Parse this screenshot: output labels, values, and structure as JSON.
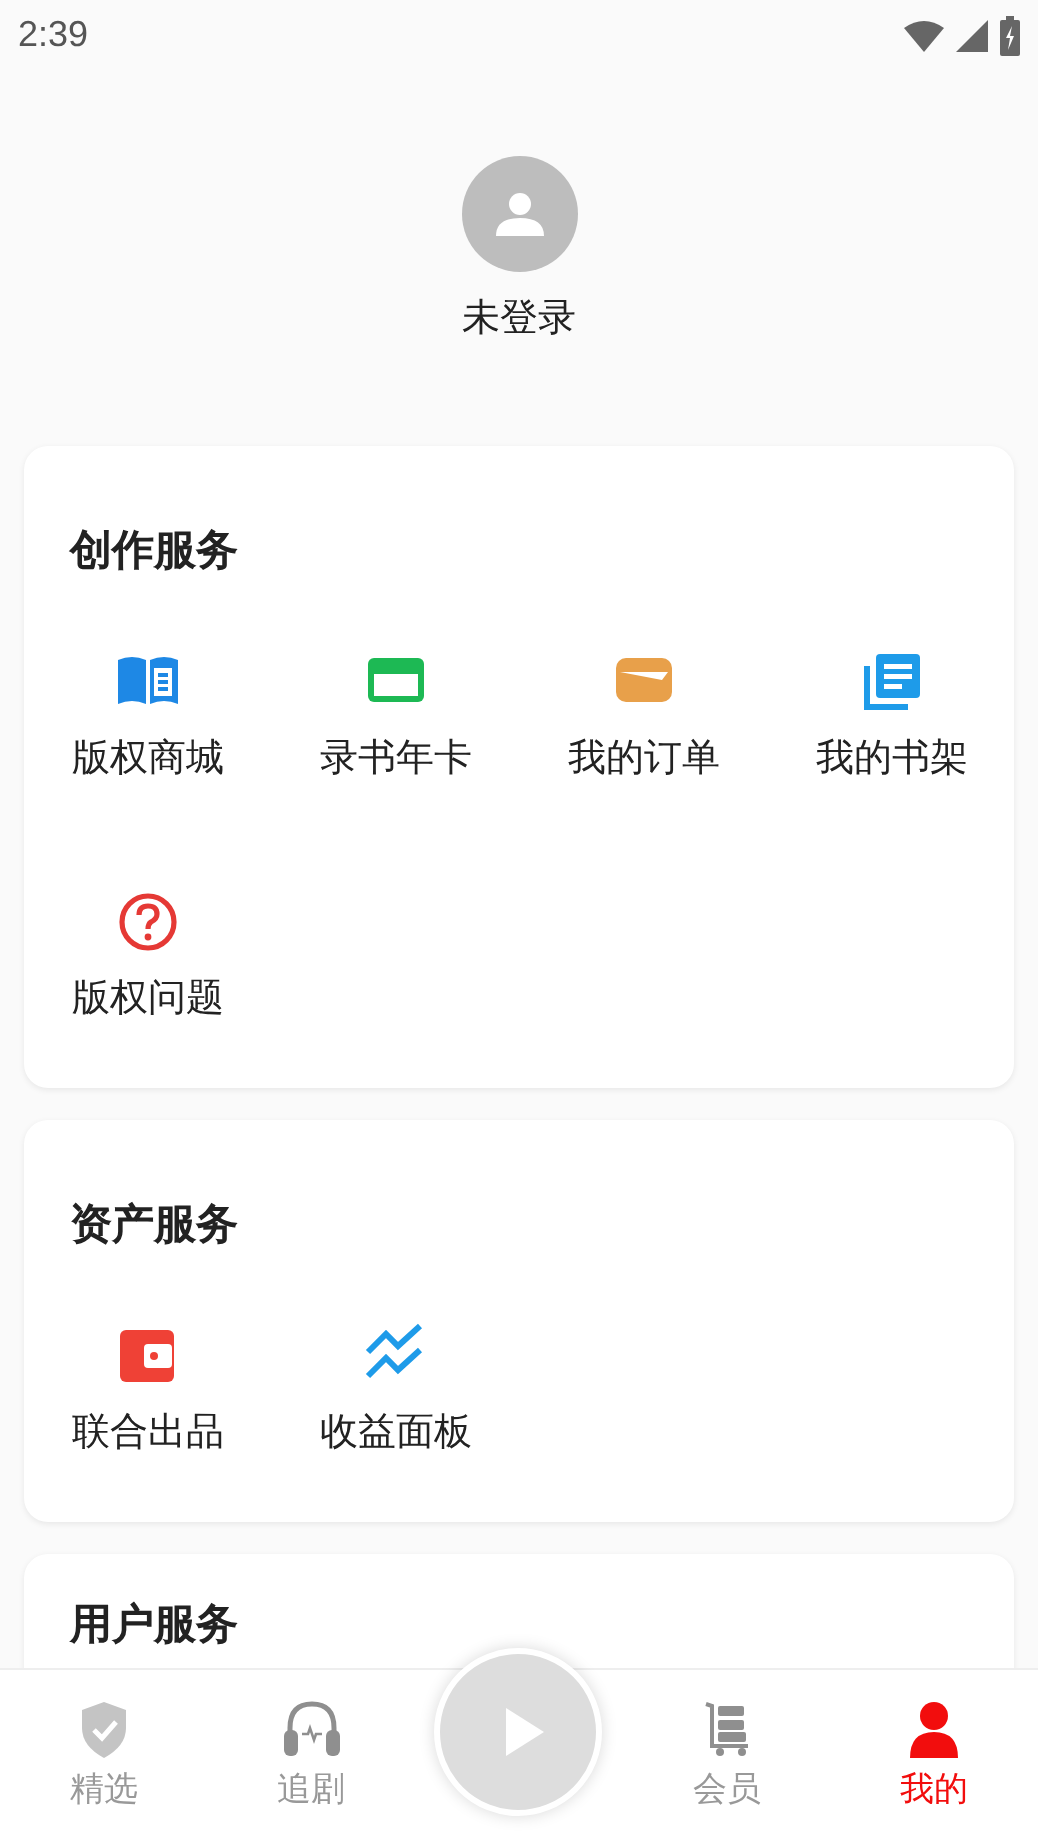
{
  "status_bar": {
    "time": "2:39"
  },
  "profile": {
    "name": "未登录"
  },
  "sections": [
    {
      "title": "创作服务",
      "items": [
        {
          "label": "版权商城"
        },
        {
          "label": "录书年卡"
        },
        {
          "label": "我的订单"
        },
        {
          "label": "我的书架"
        },
        {
          "label": "版权问题"
        }
      ]
    },
    {
      "title": "资产服务",
      "items": [
        {
          "label": "联合出品"
        },
        {
          "label": "收益面板"
        }
      ]
    },
    {
      "title": "用户服务"
    }
  ],
  "bottom_nav": {
    "items": [
      {
        "label": "精选",
        "selected": false
      },
      {
        "label": "追剧",
        "selected": false
      },
      {
        "label": "会员",
        "selected": false
      },
      {
        "label": "我的",
        "selected": true
      }
    ]
  }
}
